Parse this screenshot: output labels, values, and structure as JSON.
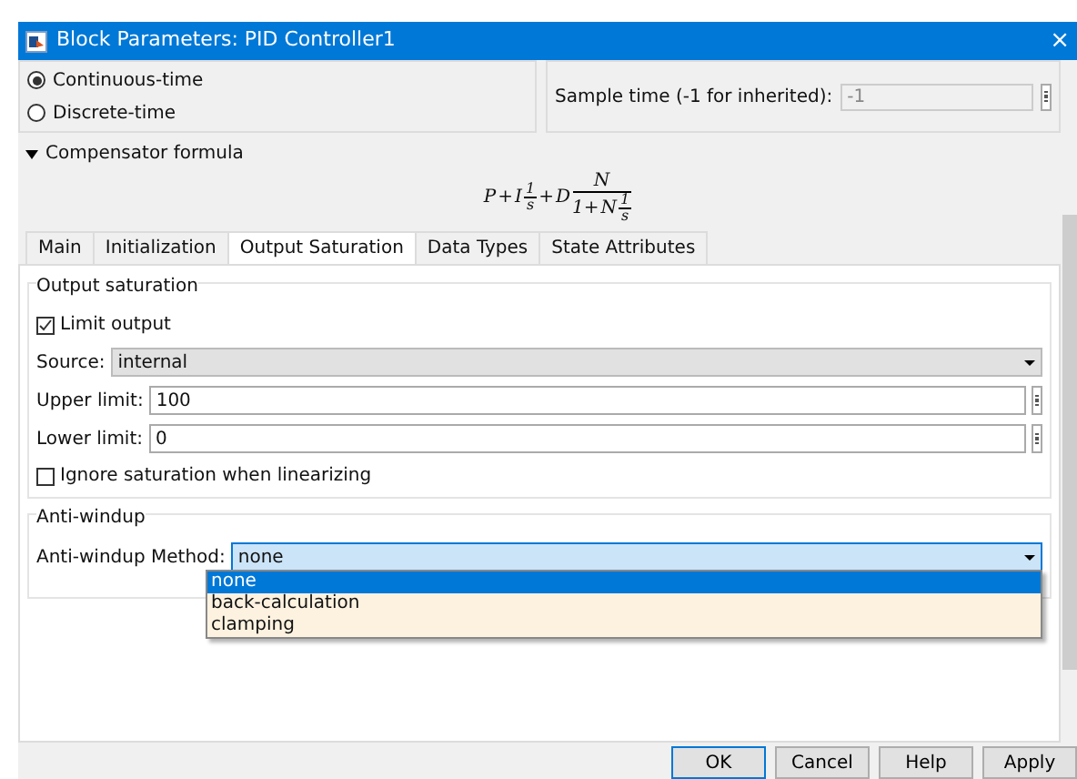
{
  "window": {
    "title": "Block Parameters: PID Controller1",
    "close": "×"
  },
  "time_domain": [
    {
      "label": "Continuous-time",
      "selected": true
    },
    {
      "label": "Discrete-time",
      "selected": false
    }
  ],
  "sample_time": {
    "label": "Sample time (-1 for inherited):",
    "value": "-1",
    "disabled": true
  },
  "compensator": {
    "label": "Compensator formula",
    "expanded": true,
    "formula": {
      "p": "P",
      "plus1": "+",
      "i": "I",
      "frac1_num": "1",
      "frac1_den": "s",
      "plus2": "+",
      "d": "D",
      "frac2_num": "N",
      "frac2_den_lead": "1+",
      "frac2_den_n": "N",
      "frac2_den_frac_num": "1",
      "frac2_den_frac_den": "s"
    }
  },
  "tabs": [
    {
      "label": "Main",
      "selected": false
    },
    {
      "label": "Initialization",
      "selected": false
    },
    {
      "label": "Output Saturation",
      "selected": true
    },
    {
      "label": "Data Types",
      "selected": false
    },
    {
      "label": "State Attributes",
      "selected": false
    }
  ],
  "output_saturation": {
    "title": "Output saturation",
    "limit_output": {
      "label": "Limit output",
      "checked": true
    },
    "source": {
      "label": "Source:",
      "value": "internal"
    },
    "upper_limit": {
      "label": "Upper limit:",
      "value": "100"
    },
    "lower_limit": {
      "label": "Lower limit:",
      "value": "0"
    },
    "ignore_saturation": {
      "label": "Ignore saturation when linearizing",
      "checked": false
    }
  },
  "anti_windup": {
    "title": "Anti-windup",
    "method_label": "Anti-windup Method:",
    "value": "none",
    "options": [
      {
        "label": "none",
        "selected": true
      },
      {
        "label": "back-calculation",
        "selected": false
      },
      {
        "label": "clamping",
        "selected": false
      }
    ]
  },
  "buttons": [
    "OK",
    "Cancel",
    "Help",
    "Apply"
  ]
}
